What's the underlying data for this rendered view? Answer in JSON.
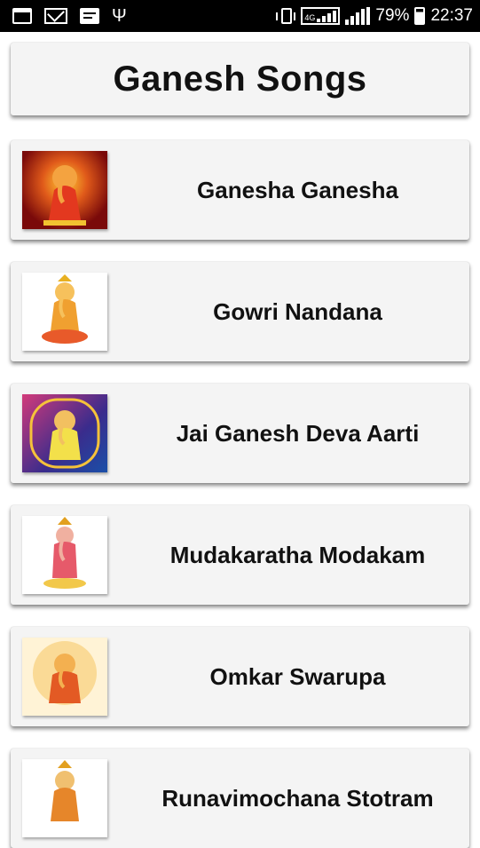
{
  "status_bar": {
    "battery_percent": "79%",
    "time": "22:37",
    "network_label": "4G",
    "left_icons": [
      "calendar-icon",
      "gmail-icon",
      "message-icon",
      "usb-icon"
    ],
    "right_icons": [
      "vibrate-icon",
      "signal-4g-icon",
      "signal-icon",
      "battery-icon"
    ]
  },
  "header": {
    "title": "Ganesh Songs"
  },
  "songs": [
    {
      "title": "Ganesha Ganesha",
      "thumb_icon": "ganesha-image-icon",
      "thumb_bg": "#7a0a0a"
    },
    {
      "title": "Gowri Nandana",
      "thumb_icon": "ganesha-image-icon",
      "thumb_bg": "#ffffff"
    },
    {
      "title": "Jai Ganesh Deva Aarti",
      "thumb_icon": "ganesha-image-icon",
      "thumb_bg": "#3a2c8c"
    },
    {
      "title": "Mudakaratha Modakam",
      "thumb_icon": "ganesha-image-icon",
      "thumb_bg": "#ffffff"
    },
    {
      "title": "Omkar Swarupa",
      "thumb_icon": "ganesha-image-icon",
      "thumb_bg": "#fff3d6"
    },
    {
      "title": "Runavimochana Stotram",
      "thumb_icon": "ganesha-image-icon",
      "thumb_bg": "#ffffff"
    }
  ]
}
